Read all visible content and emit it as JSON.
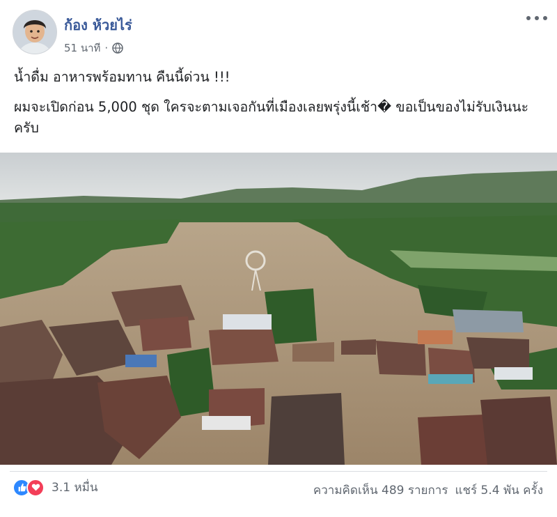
{
  "post": {
    "author": "ก้อง ห้วยไร่",
    "time": "51 นาที",
    "privacy_icon": "globe-icon",
    "line1": "น้ำดื่ม อาหารพร้อมทาน คืนนี้ด่วน !!!",
    "line2": "ผมจะเปิดก่อน 5,000 ชุด ใครจะตามเจอกันที่เมืองเลยพรุ่งนี้เช้า� ขอเป็นของไม่รับเงินนะครับ"
  },
  "engagement": {
    "reaction_count": "3.1 หมื่น",
    "comments": "ความคิดเห็น 489 รายการ",
    "shares": "แชร์ 5.4 พัน ครั้ง"
  },
  "colors": {
    "author_link": "#385898",
    "like_blue": "#2d88ff",
    "love_red": "#f33e58",
    "meta_gray": "#606770"
  }
}
